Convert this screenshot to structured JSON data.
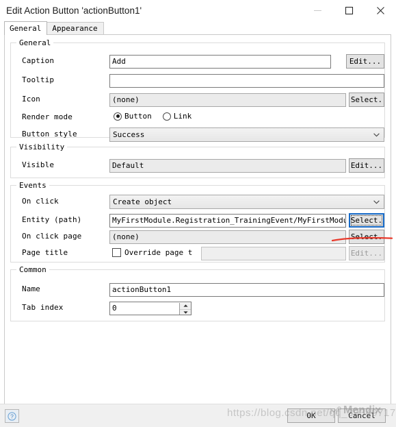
{
  "window": {
    "title": "Edit Action Button 'actionButton1'",
    "controls": {
      "minimize": "minimize-icon",
      "maximize": "maximize-icon",
      "close": "close-icon"
    }
  },
  "tabs": [
    {
      "label": "General",
      "active": true
    },
    {
      "label": "Appearance",
      "active": false
    }
  ],
  "groups": {
    "general": {
      "legend": "General",
      "rows": {
        "caption": {
          "label": "Caption",
          "value": "Add",
          "button": "Edit..."
        },
        "tooltip": {
          "label": "Tooltip",
          "value": "",
          "placeholder": ""
        },
        "icon": {
          "label": "Icon",
          "value": "(none)",
          "button": "Select."
        },
        "render_mode": {
          "label": "Render mode",
          "options": [
            {
              "label": "Button",
              "selected": true
            },
            {
              "label": "Link",
              "selected": false
            }
          ]
        },
        "button_style": {
          "label": "Button style",
          "value": "Success"
        }
      }
    },
    "visibility": {
      "legend": "Visibility",
      "rows": {
        "visible": {
          "label": "Visible",
          "value": "Default",
          "button": "Edit..."
        }
      }
    },
    "events": {
      "legend": "Events",
      "rows": {
        "on_click": {
          "label": "On click",
          "value": "Create object"
        },
        "entity_path": {
          "label": "Entity (path)",
          "value": "MyFirstModule.Registration_TrainingEvent/MyFirstModule.R",
          "button": "Select."
        },
        "on_click_page": {
          "label": "On click page",
          "value": "(none)",
          "button": "Select."
        },
        "page_title": {
          "label": "Page title",
          "checkbox_label": "Override page t",
          "checked": false,
          "value": "",
          "button": "Edit..."
        }
      }
    },
    "common": {
      "legend": "Common",
      "rows": {
        "name": {
          "label": "Name",
          "value": "actionButton1"
        },
        "tab_index": {
          "label": "Tab index",
          "value": "0"
        }
      }
    }
  },
  "footer": {
    "help": "?",
    "ok": "OK",
    "cancel": "Cancel"
  },
  "watermark": {
    "url": "https://blog.csdn.net/qq_39349717",
    "brand": "Mendix"
  },
  "colors": {
    "focus_border": "#1569c7",
    "annotation_red": "#e83a2c",
    "dialog_bg": "#ffffff",
    "footer_bg": "#f0f0f0",
    "readonly_field": "#ebebeb"
  }
}
